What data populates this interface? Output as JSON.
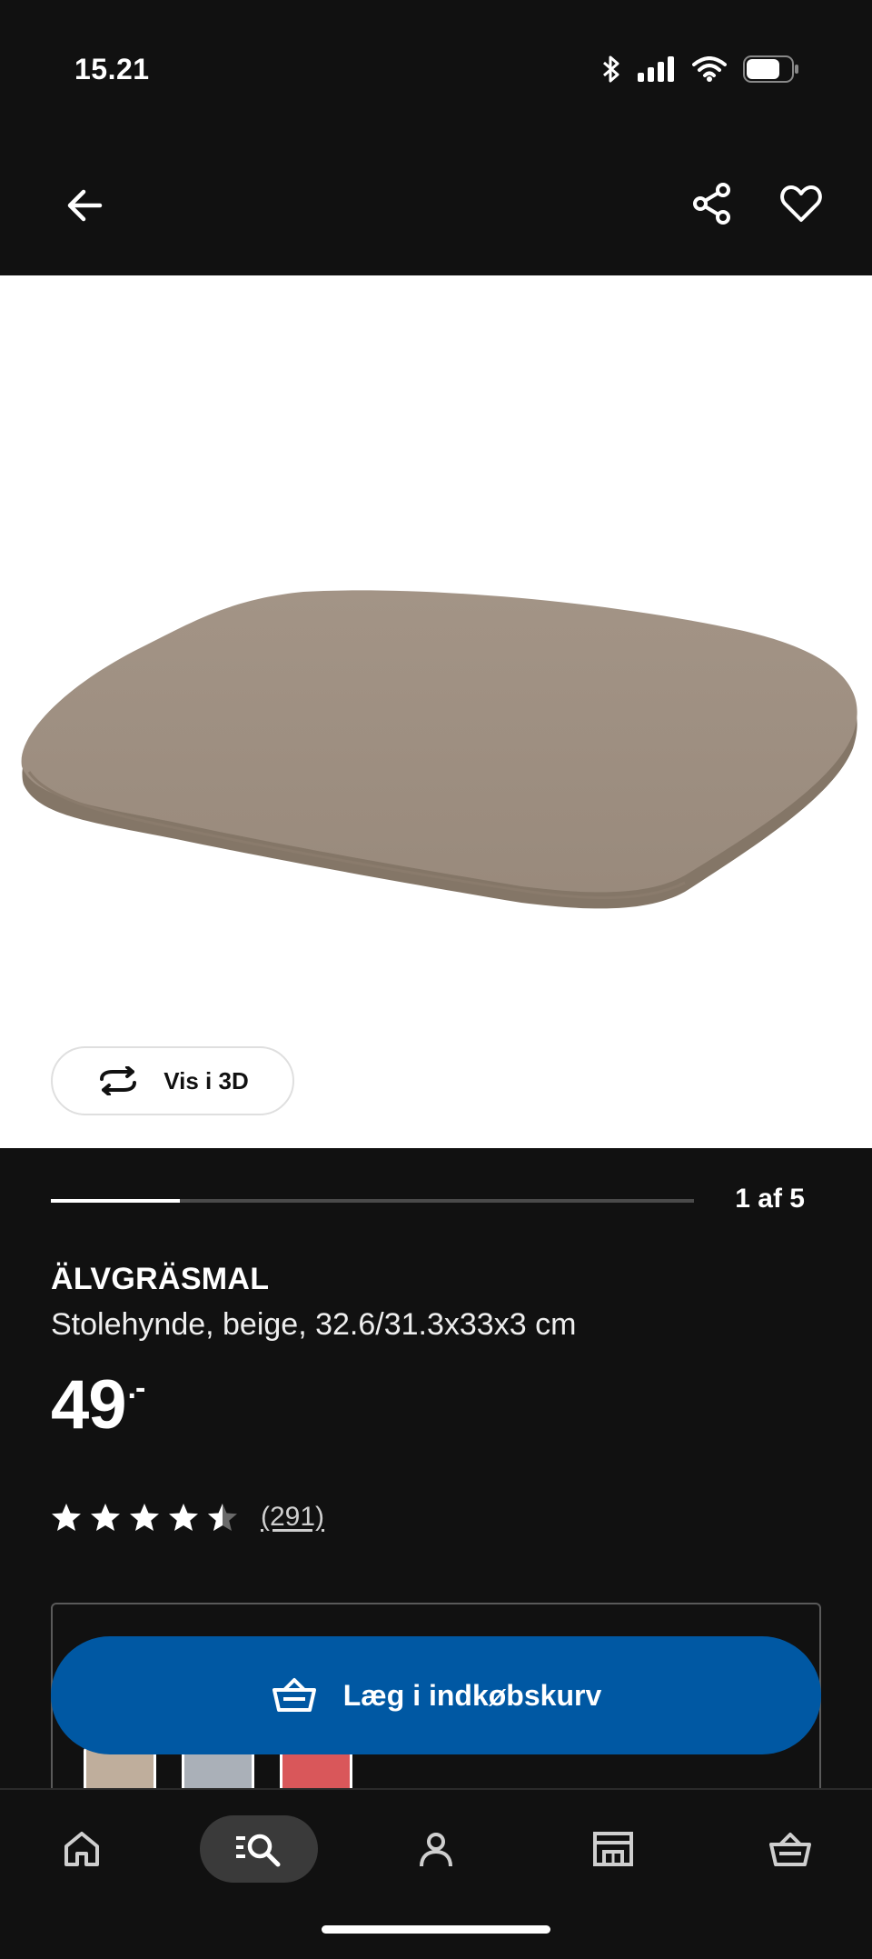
{
  "status_bar": {
    "time": "15.21",
    "icons": [
      "bluetooth-icon",
      "signal-icon",
      "wifi-icon",
      "battery-icon"
    ]
  },
  "top_nav": {
    "icons": [
      "back-arrow-icon",
      "share-icon",
      "heart-icon"
    ]
  },
  "product_image": {
    "view_3d_label": "Vis i 3D"
  },
  "carousel": {
    "current": 1,
    "total": 5,
    "counter_label": "1 af 5",
    "progress_fraction": 0.2
  },
  "product": {
    "name": "ÄLVGRÄSMAL",
    "description": "Stolehynde, beige, 32.6/31.3x33x3 cm",
    "price": "49",
    "price_suffix": ".-",
    "rating": 4.5,
    "rating_max": 5,
    "review_count": "(291)"
  },
  "variants": {
    "swatch_colors": [
      "#bfae9c",
      "#aab0b8",
      "#d9575a"
    ]
  },
  "cart_button": {
    "label": "Læg i indkøbskurv",
    "icon": "basket-icon"
  },
  "bottom_nav": {
    "items": [
      {
        "icon": "home-icon",
        "active": false
      },
      {
        "icon": "search-icon",
        "active": true
      },
      {
        "icon": "profile-icon",
        "active": false
      },
      {
        "icon": "store-icon",
        "active": false
      },
      {
        "icon": "cart-icon",
        "active": false
      }
    ]
  },
  "colors": {
    "background": "#111111",
    "accent_blue": "#0058a3",
    "white": "#ffffff"
  }
}
